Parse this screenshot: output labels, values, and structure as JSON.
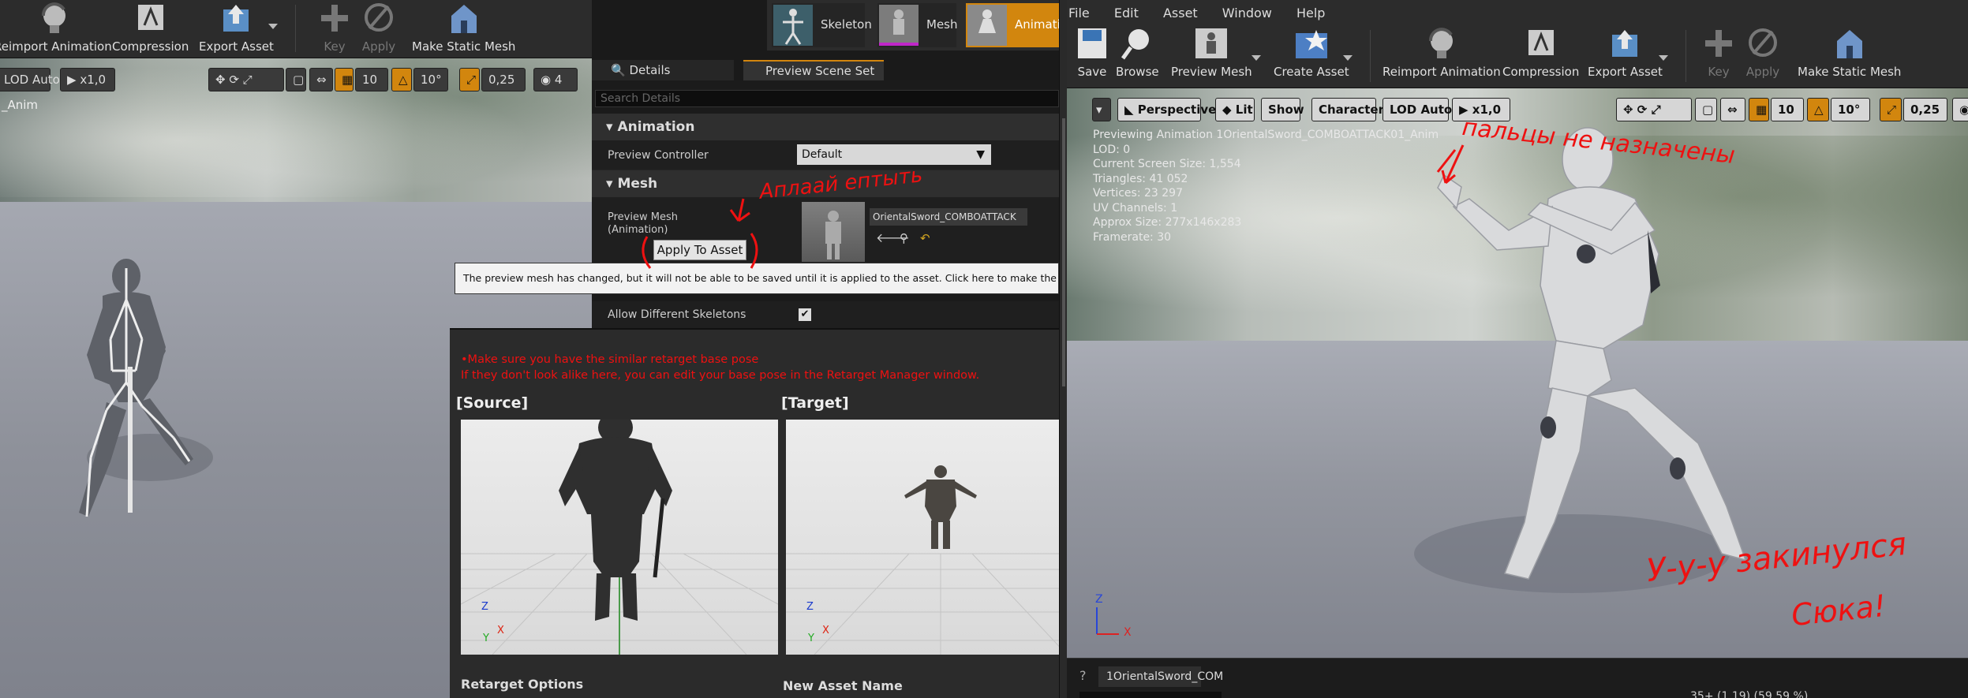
{
  "left_editor": {
    "toolbar": {
      "reimport": "Reimport Animation",
      "compression": "Compression",
      "export": "Export Asset",
      "key": "Key",
      "apply": "Apply",
      "make_static": "Make Static Mesh"
    },
    "mode_tabs": {
      "skeleton": "Skeleton",
      "mesh": "Mesh",
      "animation": "Animati"
    },
    "viewport": {
      "lod": "LOD Auto",
      "speed": "x1,0",
      "grid": "10",
      "angle": "10°",
      "scale": "0,25",
      "cam_speed": "4",
      "asset_label": "_Anim"
    }
  },
  "details": {
    "tabs": {
      "details": "Details",
      "preview_scene": "Preview Scene Set"
    },
    "search_placeholder": "Search Details",
    "animation_category": "Animation",
    "preview_controller_label": "Preview Controller",
    "preview_controller_value": "Default",
    "mesh_category": "Mesh",
    "preview_mesh_label": "Preview Mesh (Animation)",
    "preview_mesh_value": "OrientalSword_COMBOATTACK",
    "apply_to_asset": "Apply To Asset",
    "tooltip": "The preview mesh has changed, but it will not be able to be saved until it is applied to the asset. Click here to make the change to the",
    "allow_different_label": "Allow Different Skeletons",
    "allow_different_checked": true,
    "annotation_apply": "Аплаай ептыть"
  },
  "retarget": {
    "note1": "•Make sure you have the similar retarget base pose",
    "note2": "If they don't look alike here, you can edit your base pose in the Retarget Manager window.",
    "source": "[Source]",
    "target": "[Target]",
    "retarget_options": "Retarget Options",
    "new_asset_name": "New Asset Name",
    "axis_x": "X",
    "axis_y": "Y",
    "axis_z": "Z"
  },
  "right_editor": {
    "menu": [
      "File",
      "Edit",
      "Asset",
      "Window",
      "Help"
    ],
    "toolbar": {
      "save": "Save",
      "browse": "Browse",
      "preview_mesh": "Preview Mesh",
      "create_asset": "Create Asset",
      "reimport": "Reimport Animation",
      "compression": "Compression",
      "export": "Export Asset",
      "key": "Key",
      "apply": "Apply",
      "make_static": "Make Static Mesh"
    },
    "viewport": {
      "perspective": "Perspective",
      "lit": "Lit",
      "show": "Show",
      "character": "Character",
      "lod": "LOD Auto",
      "speed": "x1,0",
      "grid": "10",
      "angle": "10°",
      "scale": "0,25"
    },
    "stats": [
      "Previewing Animation 1OrientalSword_COMBOATTACK01_Anim",
      "LOD: 0",
      "Current Screen Size: 1,554",
      "Triangles: 41 052",
      "Vertices: 23 297",
      "UV Channels: 1",
      "Approx Size: 277x146x283",
      "Framerate: 30"
    ],
    "annotation_fingers": "пальцы не назначены",
    "annotation_bottom1": "У-у-у закинулся",
    "annotation_bottom2": "Сюка!",
    "timeline_tab": "1OrientalSword_COM",
    "status": "35+ (1.19) (59.59 %)"
  },
  "colors": {
    "accent_orange": "#d2860e",
    "annotation_red": "#e11111",
    "panel": "#2c2c2c",
    "viewport_floor": "#8a8d96"
  }
}
